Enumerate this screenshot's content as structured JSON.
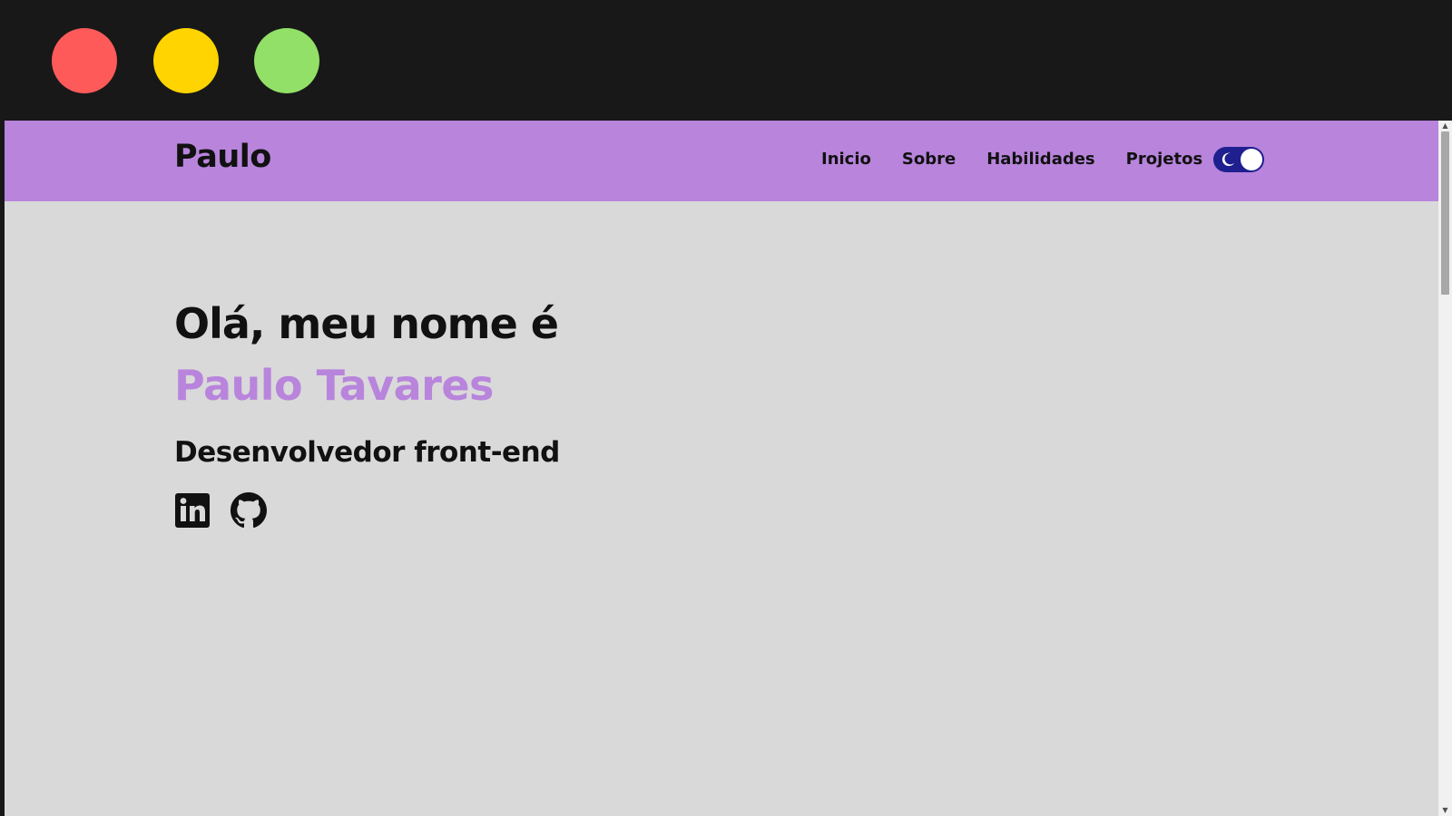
{
  "window": {
    "controls": [
      {
        "name": "close",
        "color": "#ff5a5a"
      },
      {
        "name": "minimize",
        "color": "#ffd400"
      },
      {
        "name": "maximize",
        "color": "#92e067"
      }
    ]
  },
  "navbar": {
    "brand": "Paulo",
    "links": [
      {
        "label": "Inicio"
      },
      {
        "label": "Sobre"
      },
      {
        "label": "Habilidades"
      },
      {
        "label": "Projetos"
      }
    ],
    "theme_toggle": {
      "icon": "moon-icon",
      "state": "dark"
    }
  },
  "hero": {
    "greeting": "Olá, meu nome é",
    "name": "Paulo Tavares",
    "role": "Desenvolvedor front-end",
    "social": [
      {
        "icon": "linkedin-icon"
      },
      {
        "icon": "github-icon"
      }
    ]
  },
  "colors": {
    "accent": "#b884dc",
    "background": "#d9d9d9",
    "toggle": "#1f1f8f",
    "text": "#111111"
  }
}
